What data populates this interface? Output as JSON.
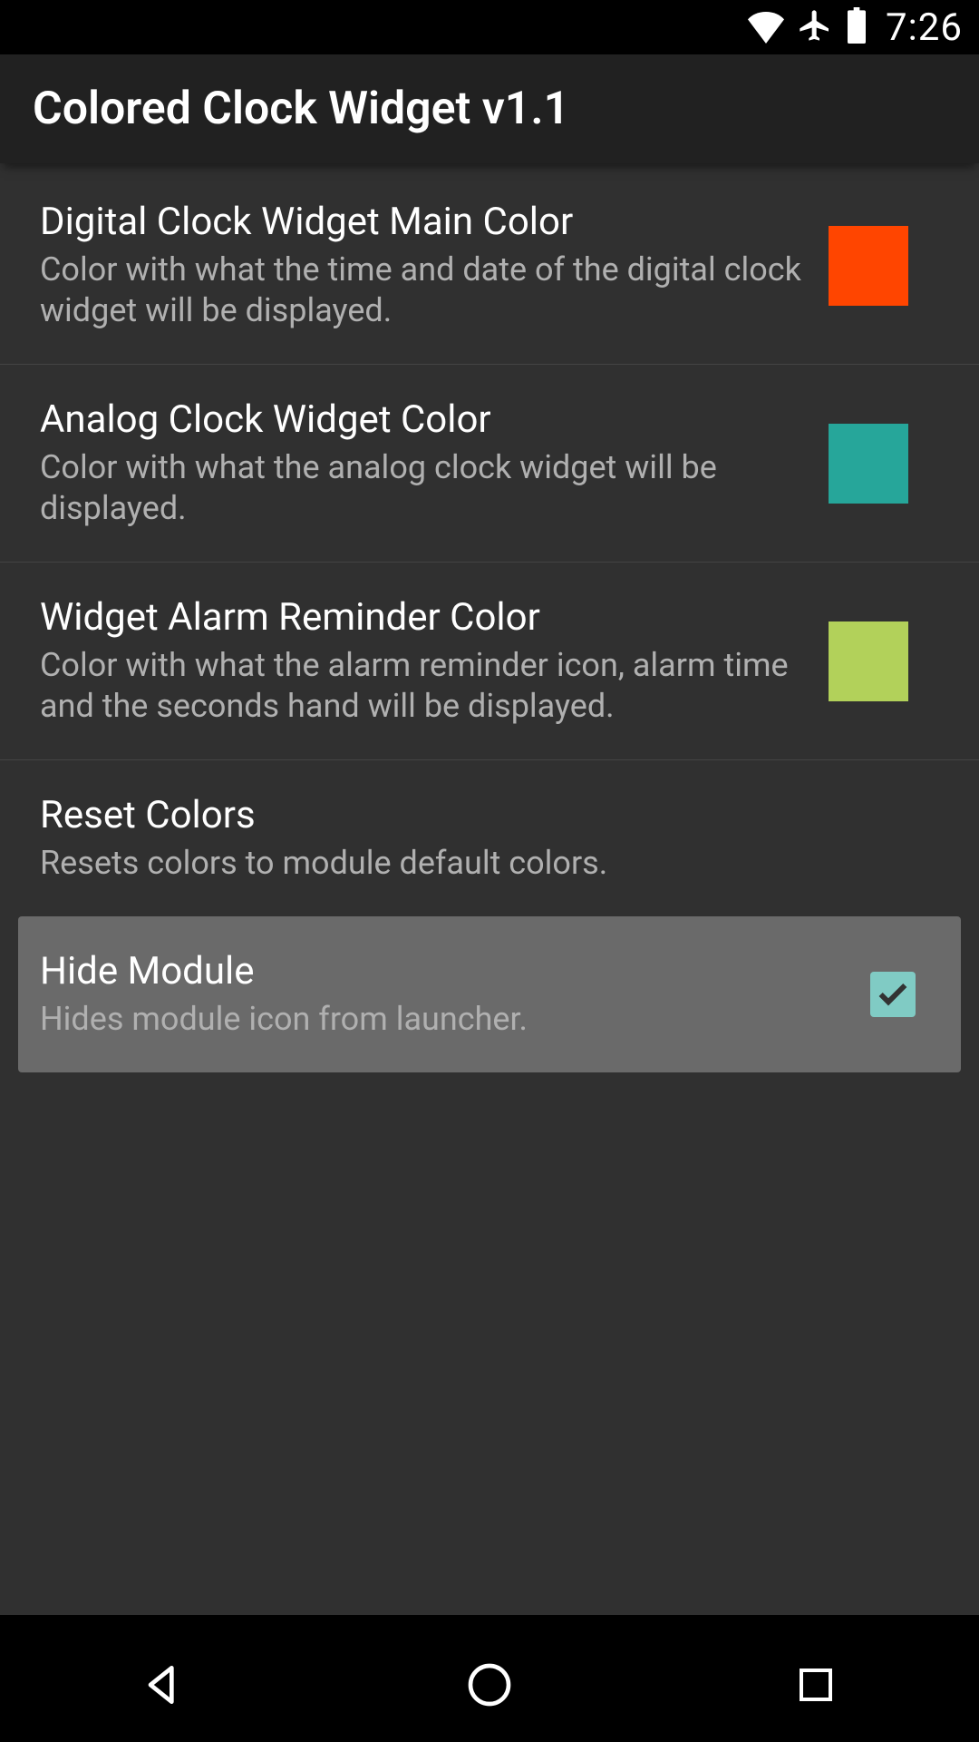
{
  "status": {
    "time": "7:26"
  },
  "header": {
    "title": "Colored Clock Widget v1.1"
  },
  "prefs": {
    "digital": {
      "title": "Digital Clock Widget Main Color",
      "subtitle": "Color with what the time and date of the digital clock widget will be displayed.",
      "color": "#ff4500"
    },
    "analog": {
      "title": "Analog Clock Widget Color",
      "subtitle": "Color with what the analog clock widget will be displayed.",
      "color": "#26a69a"
    },
    "alarm": {
      "title": "Widget Alarm Reminder Color",
      "subtitle": "Color with what the alarm reminder icon, alarm time and the seconds hand will be displayed.",
      "color": "#b2d15a"
    },
    "reset": {
      "title": "Reset Colors",
      "subtitle": "Resets colors to module default colors."
    },
    "hide": {
      "title": "Hide Module",
      "subtitle": "Hides module icon from launcher.",
      "checked": true
    }
  }
}
